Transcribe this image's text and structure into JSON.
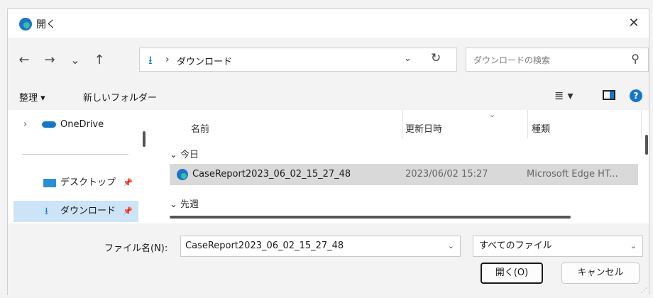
{
  "window": {
    "title": "開く",
    "close": "✕"
  },
  "nav": {
    "back": "←",
    "forward": "→",
    "recent": "⌄",
    "up": "↑"
  },
  "address": {
    "path": "ダウンロード",
    "sep": "›",
    "download_glyph": "⭳",
    "dropdown": "⌄",
    "refresh": "↻"
  },
  "search": {
    "placeholder": "ダウンロードの検索",
    "icon": "⚲"
  },
  "toolbar": {
    "organize": "整理 ▾",
    "new_folder": "新しいフォルダー",
    "view": "≣ ▾",
    "help": "?"
  },
  "sidebar": {
    "onedrive": {
      "chevron": "›",
      "label": "OneDrive"
    },
    "items": [
      {
        "label": "デスクトップ",
        "pin": "📌"
      },
      {
        "label": "ダウンロード",
        "pin": "📌"
      }
    ]
  },
  "columns": {
    "name": "名前",
    "date": "更新日時",
    "type": "種類",
    "sort": "⌄"
  },
  "groups": {
    "today": "⌄ 今日",
    "last_week": "⌄ 先週"
  },
  "files": [
    {
      "name": "CaseReport2023_06_02_15_27_48",
      "date": "2023/06/02 15:27",
      "type": "Microsoft Edge HT..."
    }
  ],
  "bottom": {
    "filename_label": "ファイル名(N):",
    "filename_value": "CaseReport2023_06_02_15_27_48",
    "filetype": "すべてのファイル",
    "dropdown": "⌄",
    "open": "開く(O)",
    "cancel": "キャンセル"
  },
  "colors": {
    "accent": "#1677c8",
    "selected_row": "#d9d9d9",
    "selected_nav": "#cde4f7"
  }
}
